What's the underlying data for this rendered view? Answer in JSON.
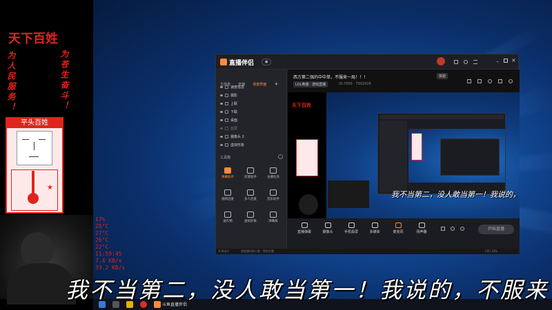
{
  "overlay": {
    "title": "天下百姓",
    "left_vertical": "为人民服务！",
    "right_vertical": "为苍生奋斗！",
    "caricature_label": "平头百姓",
    "stats": [
      "17%",
      "25°C",
      "27°C",
      "26°C",
      "22°C",
      "11:59:45",
      "7.4 KB/s",
      "33.2 KB/s"
    ]
  },
  "app": {
    "name": "直播伴侣",
    "title_text": "西方第二强的中中单，不服来一局！！！",
    "title_badge": "修改",
    "room_chip": "LOL英雄 · 游戏直播",
    "room_id_line": "ID:7500 · 7302026",
    "title_pill": "体验",
    "left_tabs": [
      "主场景",
      "直播",
      "场景界面"
    ],
    "scenes": [
      "速度信息",
      "摄影",
      "上联",
      "下联",
      "桌面",
      "蓝屏",
      "摄像头 2",
      "虚拟形象"
    ],
    "toolbox_label": "工具箱",
    "tools": [
      {
        "label": "弹幕助手",
        "hot": true
      },
      {
        "label": "房管助手",
        "hot": false
      },
      {
        "label": "主播任务",
        "hot": false
      },
      {
        "label": "视频连麦",
        "hot": false
      },
      {
        "label": "多人连麦",
        "hot": false
      },
      {
        "label": "音乐助手",
        "hot": false
      },
      {
        "label": "送礼物",
        "hot": false
      },
      {
        "label": "虚拟形象",
        "hot": false
      },
      {
        "label": "弹幕板",
        "hot": false
      }
    ],
    "bottom_buttons": [
      "直播弹幕",
      "摄像头",
      "手机投屏",
      "多媒体",
      "麦克风",
      "扬声器"
    ],
    "start_button": "开始直播",
    "status_left": "8.8kb/s",
    "status_mid": "进直播间的人数 · 等待开播",
    "status_right": "CPU 18%"
  },
  "subtitle": "我不当第二，没人敢当第一！我说的，不服来",
  "preview_subtitle": "我不当第二，没人敢当第一！我说的，不服来",
  "taskbar": {
    "app_label": "斗鱼直播伴侣"
  },
  "colors": {
    "accent_red": "#e0241b",
    "accent_orange": "#ff8a3c",
    "desktop_blue": "#124a98"
  }
}
